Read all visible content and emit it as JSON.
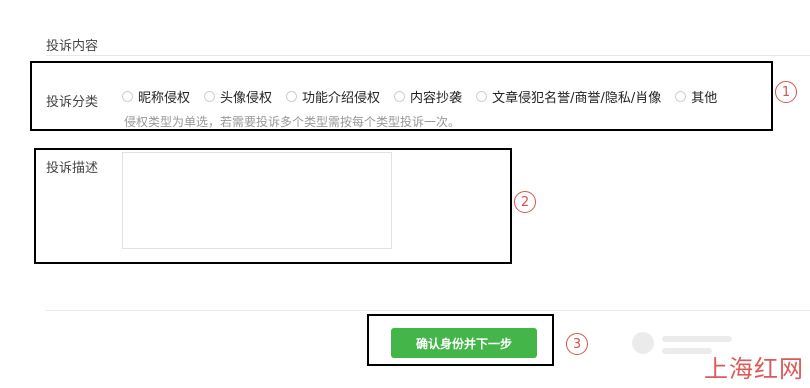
{
  "section": {
    "title": "投诉内容"
  },
  "category": {
    "label": "投诉分类",
    "options": [
      "昵称侵权",
      "头像侵权",
      "功能介绍侵权",
      "内容抄袭",
      "文章侵犯名誉/商誉/隐私/肖像",
      "其他"
    ],
    "hint": "侵权类型为单选，若需要投诉多个类型需按每个类型投诉一次。"
  },
  "description": {
    "label": "投诉描述",
    "value": ""
  },
  "actions": {
    "next_label": "确认身份并下一步",
    "button_color": "#44b549"
  },
  "annotations": {
    "step1": "1",
    "step2": "2",
    "step3": "3",
    "color": "#d9534f"
  },
  "watermark": {
    "text": "上海红网"
  }
}
